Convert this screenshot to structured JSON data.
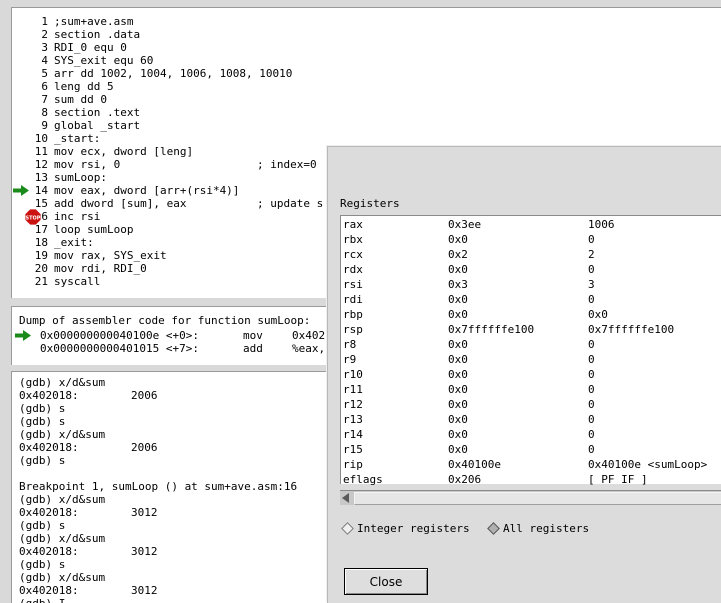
{
  "source": {
    "lines": [
      {
        "n": "1",
        "code": ";sum+ave.asm",
        "comment": ""
      },
      {
        "n": "2",
        "code": "section .data",
        "comment": ""
      },
      {
        "n": "3",
        "code": "RDI_0 equ 0",
        "comment": ""
      },
      {
        "n": "4",
        "code": "SYS_exit equ 60",
        "comment": ""
      },
      {
        "n": "5",
        "code": "arr dd 1002, 1004, 1006, 1008, 10010",
        "comment": ""
      },
      {
        "n": "6",
        "code": "leng dd 5",
        "comment": ""
      },
      {
        "n": "7",
        "code": "sum dd 0",
        "comment": ""
      },
      {
        "n": "8",
        "code": "section .text",
        "comment": ""
      },
      {
        "n": "9",
        "code": "global _start",
        "comment": ""
      },
      {
        "n": "10",
        "code": "_start:",
        "comment": ""
      },
      {
        "n": "11",
        "code": "mov ecx, dword [leng]",
        "comment": ""
      },
      {
        "n": "12",
        "code": "mov rsi, 0",
        "comment": "; index=0"
      },
      {
        "n": "13",
        "code": "sumLoop:",
        "comment": ""
      },
      {
        "n": "14",
        "code": "mov eax, dword [arr+(rsi*4)]",
        "comment": ""
      },
      {
        "n": "15",
        "code": "add dword [sum], eax",
        "comment": "; update s"
      },
      {
        "n": "16",
        "code": "inc rsi",
        "comment": ""
      },
      {
        "n": "17",
        "code": "loop sumLoop",
        "comment": ""
      },
      {
        "n": "18",
        "code": "_exit:",
        "comment": ""
      },
      {
        "n": "19",
        "code": "mov rax, SYS_exit",
        "comment": ""
      },
      {
        "n": "20",
        "code": "mov rdi, RDI_0",
        "comment": ""
      },
      {
        "n": "21",
        "code": "syscall",
        "comment": ""
      }
    ]
  },
  "assembly": {
    "header": "Dump of assembler code for function sumLoop:",
    "lines": [
      {
        "addr": "0x000000000040100e <+0>:",
        "op": "mov",
        "args": "0x402"
      },
      {
        "addr": "0x0000000000401015 <+7>:",
        "op": "add",
        "args": "%eax,"
      }
    ]
  },
  "console": {
    "lines": [
      {
        "a": "(gdb) x/d&sum",
        "b": ""
      },
      {
        "a": "0x402018:",
        "b": "2006"
      },
      {
        "a": "(gdb) s",
        "b": ""
      },
      {
        "a": "(gdb) s",
        "b": ""
      },
      {
        "a": "(gdb) x/d&sum",
        "b": ""
      },
      {
        "a": "0x402018:",
        "b": "2006"
      },
      {
        "a": "(gdb) s",
        "b": ""
      },
      {
        "a": "",
        "b": ""
      },
      {
        "a": "Breakpoint 1, sumLoop () at sum+ave.asm:16",
        "b": ""
      },
      {
        "a": "(gdb) x/d&sum",
        "b": ""
      },
      {
        "a": "0x402018:",
        "b": "3012"
      },
      {
        "a": "(gdb) s",
        "b": ""
      },
      {
        "a": "(gdb) x/d&sum",
        "b": ""
      },
      {
        "a": "0x402018:",
        "b": "3012"
      },
      {
        "a": "(gdb) s",
        "b": ""
      },
      {
        "a": "(gdb) x/d&sum",
        "b": ""
      },
      {
        "a": "0x402018:",
        "b": "3012"
      },
      {
        "a": "(gdb) I",
        "b": ""
      }
    ]
  },
  "registers": {
    "title": "Registers",
    "rows": [
      {
        "name": "rax",
        "hex": "0x3ee",
        "value": "1006"
      },
      {
        "name": "rbx",
        "hex": "0x0",
        "value": "0"
      },
      {
        "name": "rcx",
        "hex": "0x2",
        "value": "2"
      },
      {
        "name": "rdx",
        "hex": "0x0",
        "value": "0"
      },
      {
        "name": "rsi",
        "hex": "0x3",
        "value": "3"
      },
      {
        "name": "rdi",
        "hex": "0x0",
        "value": "0"
      },
      {
        "name": "rbp",
        "hex": "0x0",
        "value": "0x0"
      },
      {
        "name": "rsp",
        "hex": "0x7ffffffe100",
        "value": "0x7ffffffe100"
      },
      {
        "name": "r8",
        "hex": "0x0",
        "value": "0"
      },
      {
        "name": "r9",
        "hex": "0x0",
        "value": "0"
      },
      {
        "name": "r10",
        "hex": "0x0",
        "value": "0"
      },
      {
        "name": "r11",
        "hex": "0x0",
        "value": "0"
      },
      {
        "name": "r12",
        "hex": "0x0",
        "value": "0"
      },
      {
        "name": "r13",
        "hex": "0x0",
        "value": "0"
      },
      {
        "name": "r14",
        "hex": "0x0",
        "value": "0"
      },
      {
        "name": "r15",
        "hex": "0x0",
        "value": "0"
      },
      {
        "name": "rip",
        "hex": "0x40100e",
        "value": "0x40100e <sumLoop>"
      },
      {
        "name": "eflags",
        "hex": "0x206",
        "value": "[ PF IF ]"
      }
    ],
    "radio_integer": "Integer registers",
    "radio_all": "All registers",
    "selected": "all",
    "close_label": "Close"
  },
  "markers": {
    "arrow_icon": "green-arrow-icon",
    "arrow_color": "#1a8a1a",
    "stop_icon": "stop-sign-icon",
    "stop_color": "#cc1111",
    "stop_text": "STOP"
  }
}
